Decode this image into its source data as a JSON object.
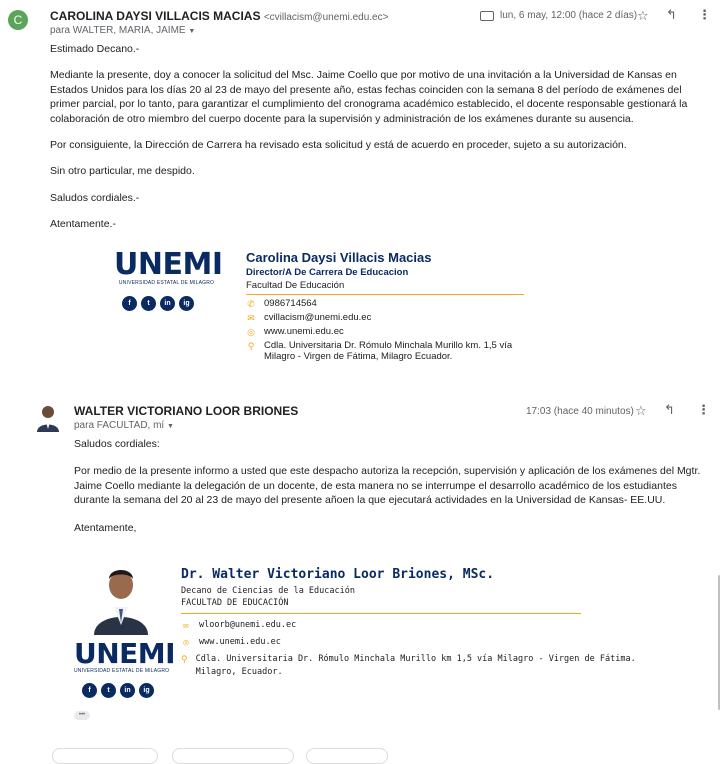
{
  "email1": {
    "avatar_letter": "C",
    "sender_name": "CAROLINA DAYSI VILLACIS MACIAS",
    "sender_email": "<cvillacism@unemi.edu.ec>",
    "to_prefix": "para WALTER, MARIA, JAIME",
    "timestamp": "lun, 6 may, 12:00 (hace 2 días)",
    "greeting": "Estimado Decano.-",
    "paragraph1": "Mediante la presente, doy a conocer la solicitud del Msc. Jaime Coello que por motivo de una invitación a la Universidad de Kansas en Estados Unidos para los días 20 al 23 de mayo del presente año, estas fechas coinciden con la semana 8 del período de exámenes del primer parcial, por lo tanto, para garantizar el cumplimiento del cronograma académico establecido, el docente responsable gestionará la colaboración de otro miembro del cuerpo docente para la supervisión y administración de los exámenes durante su ausencia.",
    "paragraph2": "Por consiguiente, la Dirección de Carrera ha revisado esta solicitud y está de acuerdo en proceder, sujeto a su autorización.",
    "paragraph3": "Sin otro particular, me despido.",
    "paragraph4": "Saludos cordiales.-",
    "closing": "Atentamente.-",
    "signature": {
      "logo_text": "UNEMI",
      "logo_sub": "UNIVERSIDAD ESTATAL DE MILAGRO",
      "social": [
        "f",
        "t",
        "in",
        "ig"
      ],
      "name": "Carolina Daysi Villacis Macias",
      "title": "Director/A De Carrera De Educacion",
      "faculty": "Facultad De Educación",
      "phone": "0986714564",
      "email": "cvillacism@unemi.edu.ec",
      "web": "www.unemi.edu.ec",
      "address": "Cdla. Universitaria Dr. Rómulo Minchala Murillo km. 1,5 vía Milagro - Virgen de Fátima, Milagro Ecuador."
    }
  },
  "email2": {
    "sender_name": "WALTER VICTORIANO LOOR BRIONES",
    "to_prefix": "para FACULTAD, mí",
    "timestamp": "17:03 (hace 40 minutos)",
    "greeting": "Saludos cordiales:",
    "paragraph1": "Por medio de la presente informo a usted que este despacho autoriza la recepción, supervisión y aplicación  de los exámenes del Mgtr. Jaime Coello mediante la delegación de un docente, de esta manera no se interrumpe el desarrollo académico de los estudiantes durante la semana del 20 al 23 de mayo del presente añoen la que ejecutará actividades en la Universidad de Kansas- EE.UU.",
    "closing": "Atentamente,",
    "signature": {
      "logo_text": "UNEMI",
      "logo_sub": "UNIVERSIDAD ESTATAL DE MILAGRO",
      "social": [
        "f",
        "t",
        "in",
        "ig"
      ],
      "name": "Dr. Walter Victoriano Loor Briones, MSc.",
      "title": "Decano de Ciencias de la Educación",
      "faculty": "FACULTAD DE EDUCACIÓN",
      "email": "wloorb@unemi.edu.ec",
      "web": "www.unemi.edu.ec",
      "address_line1": "Cdla. Universitaria Dr. Rómulo Minchala Murillo km 1,5 vía Milagro - Virgen de Fátima.",
      "address_line2": "Milagro, Ecuador."
    },
    "trimmed_indicator": "•••"
  },
  "colors": {
    "brand_navy": "#0a2b61",
    "accent_orange": "#f5a623",
    "avatar_green": "#5aa45c",
    "muted_text": "#5f6368"
  },
  "icons": {
    "star": "star-icon",
    "reply": "reply-icon",
    "more": "more-vert-icon",
    "label": "label-icon"
  }
}
